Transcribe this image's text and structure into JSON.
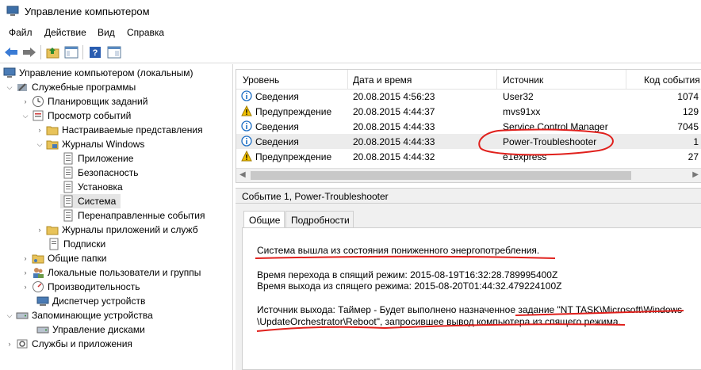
{
  "window": {
    "title": "Управление компьютером"
  },
  "menu": [
    "Файл",
    "Действие",
    "Вид",
    "Справка"
  ],
  "tree": [
    {
      "label": "Управление компьютером (локальным)",
      "icon": "computer-icon"
    },
    {
      "label": "Служебные программы",
      "icon": "tools-icon"
    },
    {
      "label": "Планировщик заданий",
      "icon": "clock-icon"
    },
    {
      "label": "Просмотр событий",
      "icon": "event-viewer-icon"
    },
    {
      "label": "Настраиваемые представления",
      "icon": "folder-icon"
    },
    {
      "label": "Журналы Windows",
      "icon": "folder-icon"
    },
    {
      "label": "Приложение",
      "icon": "log-icon"
    },
    {
      "label": "Безопасность",
      "icon": "log-icon"
    },
    {
      "label": "Установка",
      "icon": "log-icon"
    },
    {
      "label": "Система",
      "icon": "log-icon"
    },
    {
      "label": "Перенаправленные события",
      "icon": "log-icon"
    },
    {
      "label": "Журналы приложений и служб",
      "icon": "folder-icon"
    },
    {
      "label": "Подписки",
      "icon": "log-icon"
    },
    {
      "label": "Общие папки",
      "icon": "shared-folder-icon"
    },
    {
      "label": "Локальные пользователи и группы",
      "icon": "users-icon"
    },
    {
      "label": "Производительность",
      "icon": "performance-icon"
    },
    {
      "label": "Диспетчер устройств",
      "icon": "device-manager-icon"
    },
    {
      "label": "Запоминающие устройства",
      "icon": "storage-icon"
    },
    {
      "label": "Управление дисками",
      "icon": "disk-icon"
    },
    {
      "label": "Службы и приложения",
      "icon": "services-icon"
    }
  ],
  "list": {
    "columns": [
      "Уровень",
      "Дата и время",
      "Источник",
      "Код события"
    ],
    "rows": [
      {
        "level": "Сведения",
        "date": "20.08.2015 4:56:23",
        "source": "User32",
        "code": "1074",
        "type": "info"
      },
      {
        "level": "Предупреждение",
        "date": "20.08.2015 4:44:37",
        "source": "mvs91xx",
        "code": "129",
        "type": "warning"
      },
      {
        "level": "Сведения",
        "date": "20.08.2015 4:44:33",
        "source": "Service Control Manager",
        "code": "7045",
        "type": "info"
      },
      {
        "level": "Сведения",
        "date": "20.08.2015 4:44:33",
        "source": "Power-Troubleshooter",
        "code": "1",
        "type": "info"
      },
      {
        "level": "Предупреждение",
        "date": "20.08.2015 4:44:32",
        "source": "e1express",
        "code": "27",
        "type": "warning"
      }
    ]
  },
  "detail": {
    "title": "Событие 1, Power-Troubleshooter",
    "tabs": [
      "Общие",
      "Подробности"
    ],
    "line1": "Система вышла из состояния пониженного энергопотребления.",
    "line2": "Время перехода в спящий режим: 2015-08-19T16:32:28.789995400Z",
    "line3": "Время выхода из спящего режима: 2015-08-20T01:44:32.479224100Z",
    "line4": "Источник выхода: Таймер - Будет выполнено назначенное задание \"NT TASK\\Microsoft\\Windows",
    "line5": "\\UpdateOrchestrator\\Reboot\", запросившее вывод компьютера из спящего режима."
  },
  "colors": {
    "annotation": "#e0201c",
    "info": "#1e6fc4",
    "warning": "#f2c200"
  }
}
